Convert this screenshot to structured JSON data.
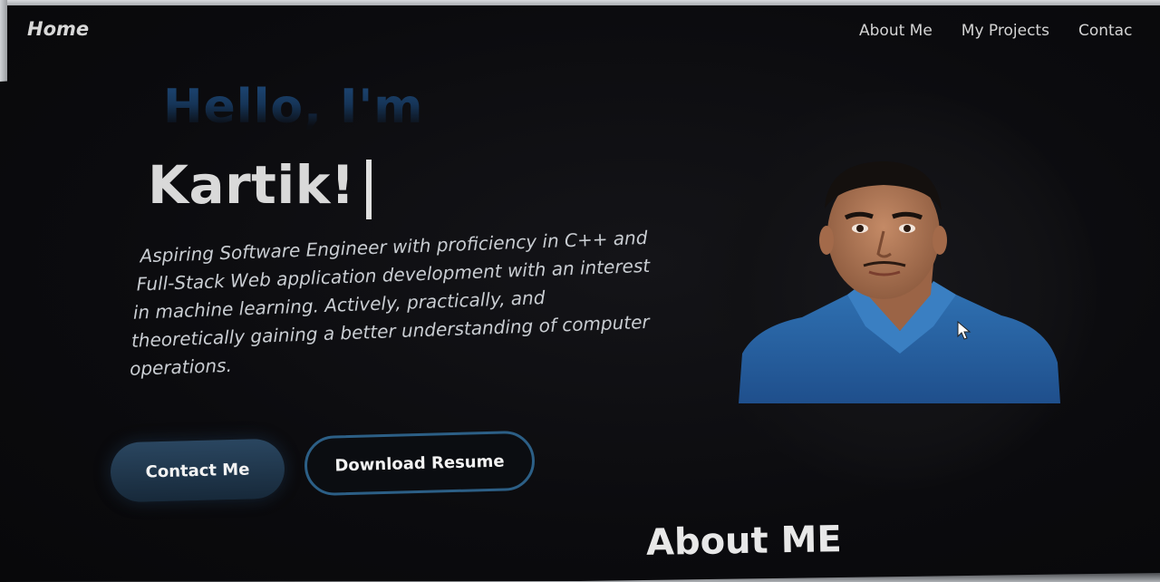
{
  "nav": {
    "home": "Home",
    "links": [
      "About Me",
      "My Projects",
      "Contac"
    ]
  },
  "hero": {
    "greeting": "Hello, I'm",
    "name": "Kartik!",
    "bio_lines": [
      "Aspiring Software Engineer with proficiency in C++ and",
      "Full-Stack Web application development with an interest",
      "in machine learning. Actively, practically, and",
      "theoretically gaining a better understanding of computer",
      "operations."
    ],
    "buttons": {
      "contact": "Contact Me",
      "resume": "Download Resume"
    }
  },
  "about": {
    "heading": "About ME"
  },
  "colors": {
    "accent_blue": "#2c5f86",
    "background": "#0c0c0f",
    "greeting_gradient": "#1e4a7a"
  }
}
